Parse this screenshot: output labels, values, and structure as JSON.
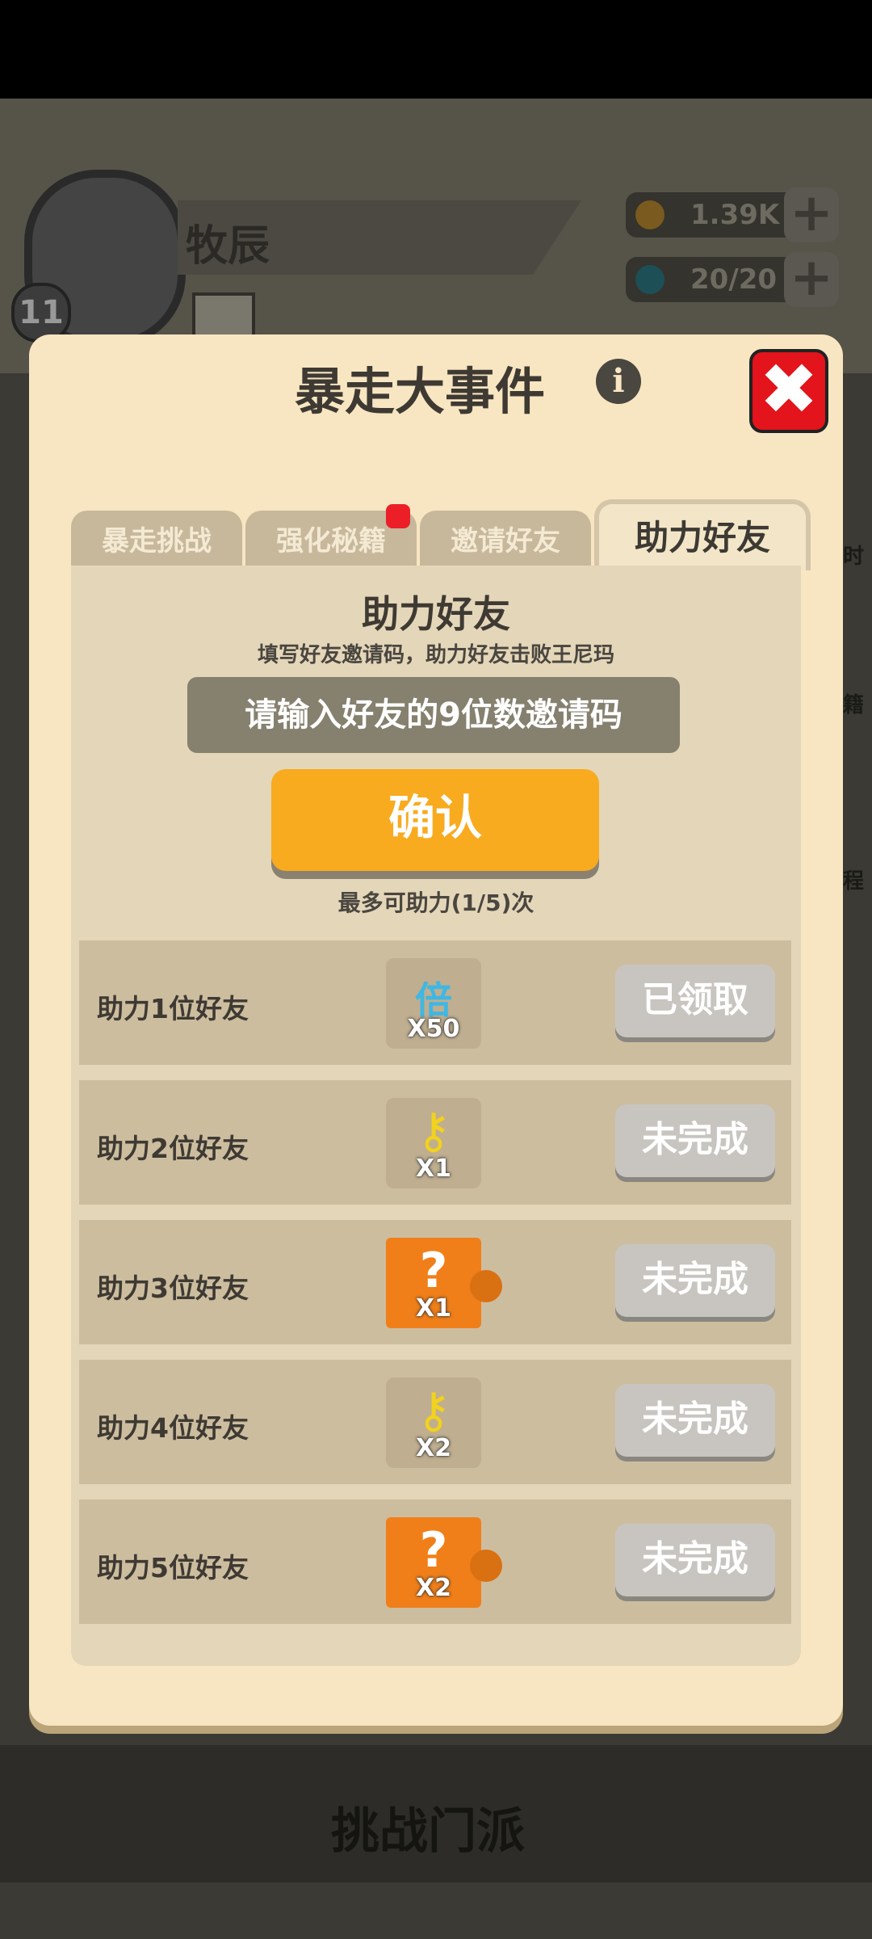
{
  "background": {
    "player_name": "牧辰",
    "level": "11",
    "coins": "1.39K",
    "energy": "20/20",
    "plus_glyph": "+",
    "bottom_title": "挑战门派",
    "side_hints": [
      "时",
      "籍",
      "程"
    ]
  },
  "dialog": {
    "title": "暴走大事件",
    "info_glyph": "i",
    "close_glyph": "✖",
    "tabs": [
      {
        "label": "暴走挑战"
      },
      {
        "label": "强化秘籍",
        "has_dot": true
      },
      {
        "label": "邀请好友"
      },
      {
        "label": "助力好友",
        "active": true
      }
    ],
    "section_title": "助力好友",
    "section_subtitle": "填写好友邀请码，助力好友击败王尼玛",
    "input_placeholder": "请输入好友的9位数邀请码",
    "confirm_label": "确认",
    "limit_text": "最多可助力(1/5)次",
    "rows": [
      {
        "label": "助力1位好友",
        "reward_icon": "diamond-multiplier-icon",
        "reward_glyph": "倍",
        "quantity": "X50",
        "status": "已领取"
      },
      {
        "label": "助力2位好友",
        "reward_icon": "key-icon",
        "reward_glyph": "⚷",
        "quantity": "X1",
        "status": "未完成"
      },
      {
        "label": "助力3位好友",
        "reward_icon": "mystery-puzzle-icon",
        "reward_glyph": "?",
        "quantity": "X1",
        "status": "未完成"
      },
      {
        "label": "助力4位好友",
        "reward_icon": "key-icon",
        "reward_glyph": "⚷",
        "quantity": "X2",
        "status": "未完成"
      },
      {
        "label": "助力5位好友",
        "reward_icon": "mystery-puzzle-icon",
        "reward_glyph": "?",
        "quantity": "X2",
        "status": "未完成"
      }
    ]
  },
  "colors": {
    "dialog_bg": "#f8e6c2",
    "confirm": "#f8ab1f",
    "close": "#e3141b",
    "puzzle": "#f07f19"
  }
}
